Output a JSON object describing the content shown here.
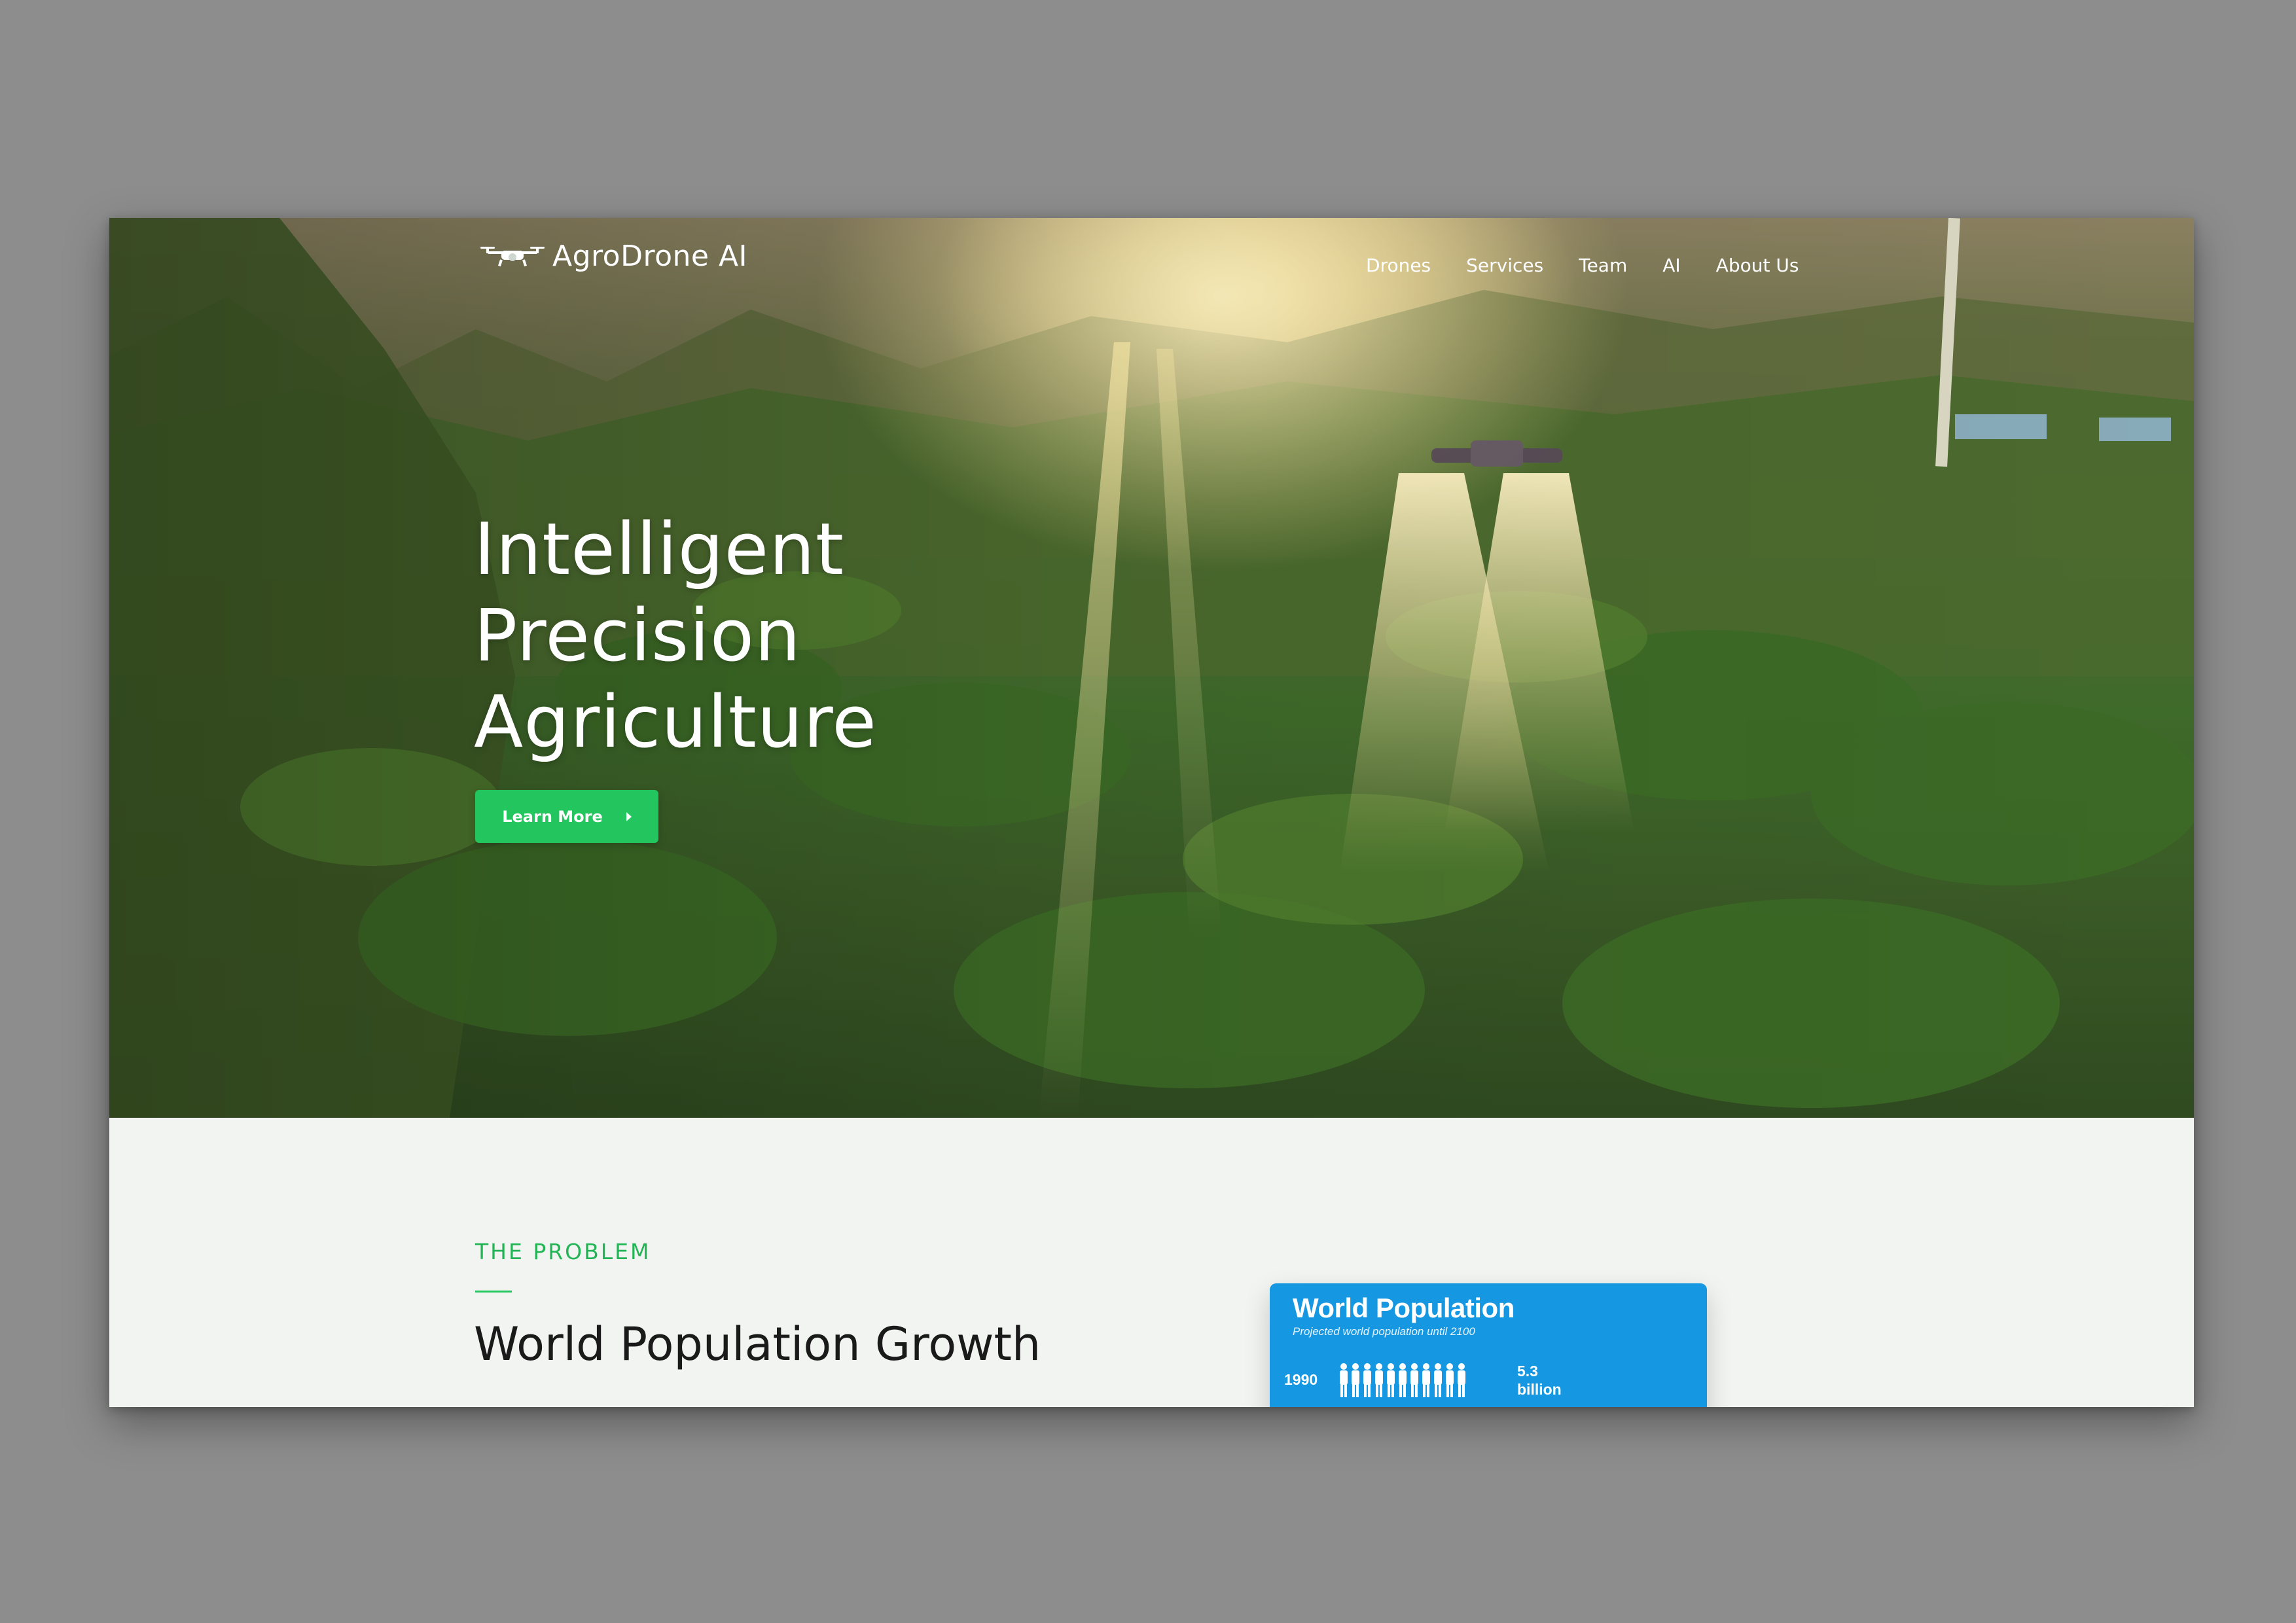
{
  "nav": {
    "brand": "AgroDrone AI",
    "items": [
      {
        "label": "Drones"
      },
      {
        "label": "Services"
      },
      {
        "label": "Team"
      },
      {
        "label": "AI"
      },
      {
        "label": "About Us"
      }
    ]
  },
  "hero": {
    "title_lines": [
      "Intelligent",
      "Precision",
      "Agriculture"
    ],
    "cta_label": "Learn More",
    "image": "drone-spraying-orchard"
  },
  "problem": {
    "eyebrow": "THE PROBLEM",
    "title": "World Population Growth",
    "infographic": {
      "title": "World Population",
      "subtitle": "Projected world population until 2100",
      "year": "1990",
      "value_number": "5.3",
      "value_unit": "billion"
    }
  },
  "colors": {
    "accent": "#22c55e",
    "info_card": "#1597e2",
    "section_bg": "#f2f4f2",
    "backdrop": "#8d8d8d"
  }
}
